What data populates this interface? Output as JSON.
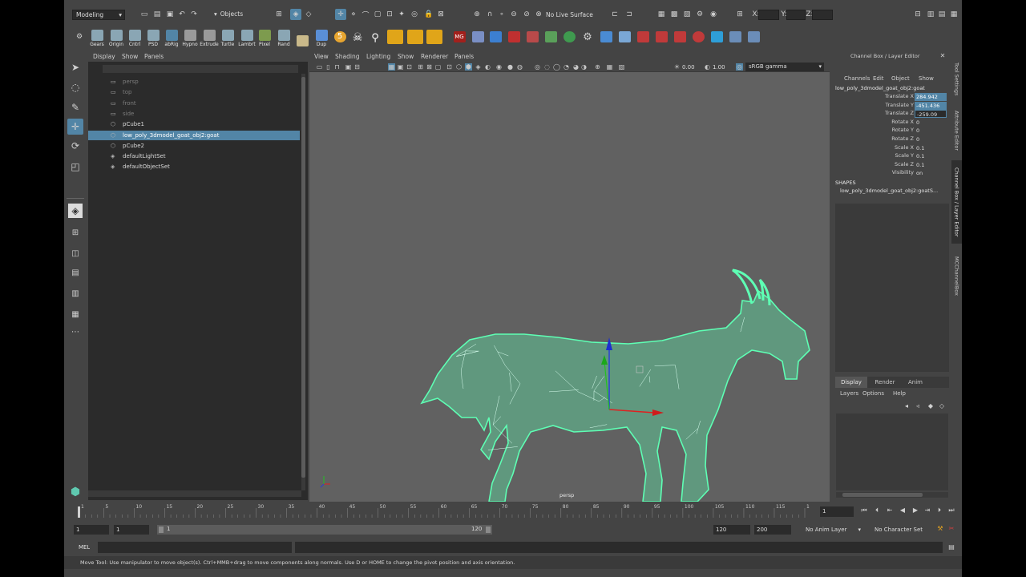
{
  "status_line": {
    "mode": "Modeling",
    "selection_mask": "Objects",
    "live_surface": "No Live Surface",
    "coord_labels": [
      "X:",
      "Y:",
      "Z:"
    ]
  },
  "shelf": {
    "items": [
      {
        "label": "Gears",
        "color": "#8aa6b4"
      },
      {
        "label": "Origin",
        "color": "#8aa6b4"
      },
      {
        "label": "Cntrl",
        "color": "#8aa6b4"
      },
      {
        "label": "PSD",
        "color": "#8aa6b4"
      },
      {
        "label": "abRig",
        "color": "#5285a6"
      },
      {
        "label": "Hypno",
        "color": "#9a9a9a"
      },
      {
        "label": "Extrude",
        "color": "#9a9a9a"
      },
      {
        "label": "Turtle",
        "color": "#8aa6b4"
      },
      {
        "label": "Lambrt",
        "color": "#8aa6b4"
      },
      {
        "label": "Pixel",
        "color": "#7d9b4e"
      },
      {
        "label": "Rand",
        "color": "#8aa6b4"
      },
      {
        "label": "",
        "color": "#c9b98a"
      },
      {
        "label": "Dup",
        "color": "#5a8fd6"
      }
    ]
  },
  "outliner": {
    "menu": [
      "Display",
      "Show",
      "Panels"
    ],
    "items": [
      {
        "label": "persp",
        "kind": "camera"
      },
      {
        "label": "top",
        "kind": "camera"
      },
      {
        "label": "front",
        "kind": "camera"
      },
      {
        "label": "side",
        "kind": "camera"
      },
      {
        "label": "pCube1",
        "kind": "mesh"
      },
      {
        "label": "low_poly_3dmodel_goat_obj2:goat",
        "kind": "mesh",
        "selected": true
      },
      {
        "label": "pCube2",
        "kind": "mesh"
      },
      {
        "label": "defaultLightSet",
        "kind": "set"
      },
      {
        "label": "defaultObjectSet",
        "kind": "set"
      }
    ]
  },
  "viewport": {
    "menu": [
      "View",
      "Shading",
      "Lighting",
      "Show",
      "Renderer",
      "Panels"
    ],
    "exposure": "0.00",
    "gamma": "1.00",
    "color_space": "sRGB gamma",
    "camera_label": "persp",
    "mesh_color": "#5effb4",
    "bg_color": "#616161"
  },
  "channel_box": {
    "header": "Channel Box / Layer Editor",
    "menu": [
      "Channels",
      "Edit",
      "Object",
      "Show"
    ],
    "object_name": "low_poly_3dmodel_goat_obj2:goat",
    "attributes": [
      {
        "label": "Translate X",
        "value": "284.942",
        "hl": true
      },
      {
        "label": "Translate Y",
        "value": "-451.436",
        "hl": true
      },
      {
        "label": "Translate Z",
        "value": "-259.09",
        "hl": false,
        "editing": true
      },
      {
        "label": "Rotate X",
        "value": "0"
      },
      {
        "label": "Rotate Y",
        "value": "0"
      },
      {
        "label": "Rotate Z",
        "value": "0"
      },
      {
        "label": "Scale X",
        "value": "0.1"
      },
      {
        "label": "Scale Y",
        "value": "0.1"
      },
      {
        "label": "Scale Z",
        "value": "0.1"
      },
      {
        "label": "Visibility",
        "value": "on"
      }
    ],
    "shapes_header": "SHAPES",
    "shape_name": "low_poly_3dmodel_goat_obj2:goatS...",
    "layer_tabs": [
      "Display",
      "Render",
      "Anim"
    ],
    "layer_menu": [
      "Layers",
      "Options",
      "Help"
    ]
  },
  "side_tabs": [
    "Tool Settings",
    "Attribute Editor",
    "Channel Box / Layer Editor",
    "MCChannelBox"
  ],
  "time_slider": {
    "ticks": [
      "1",
      "5",
      "10",
      "15",
      "20",
      "25",
      "30",
      "35",
      "40",
      "45",
      "50",
      "55",
      "60",
      "65",
      "70",
      "75",
      "80",
      "85",
      "90",
      "95",
      "100",
      "105",
      "110",
      "115",
      "120"
    ],
    "current_frame": "1"
  },
  "range_slider": {
    "start": "1",
    "playback_start": "1",
    "range_start_label": "1",
    "range_end_label": "120",
    "playback_end": "120",
    "end": "200",
    "anim_layer": "No Anim Layer",
    "character_set": "No Character Set"
  },
  "command_line": {
    "label": "MEL"
  },
  "help_line": "Move Tool: Use manipulator to move object(s). Ctrl+MMB+drag to move components along normals. Use D or HOME to change the pivot position and axis orientation."
}
